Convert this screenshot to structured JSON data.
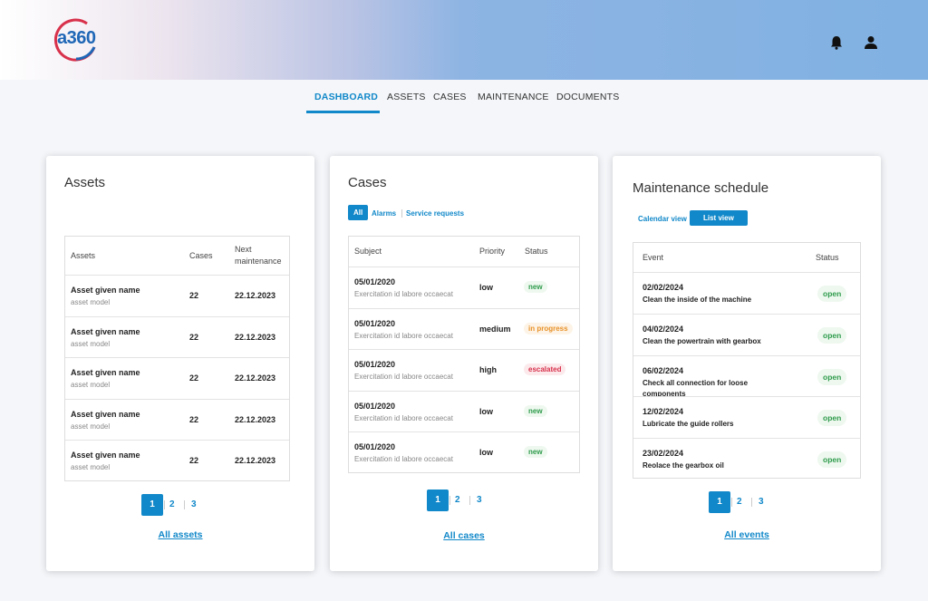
{
  "header": {
    "logo_text": "a360",
    "brand_color": "#1f67b6",
    "accent_red": "#d8314b"
  },
  "nav": {
    "items": [
      {
        "label": "DASHBOARD",
        "active": true
      },
      {
        "label": "ASSETS"
      },
      {
        "label": "CASES"
      },
      {
        "label": "MAINTENANCE"
      },
      {
        "label": "DOCUMENTS"
      }
    ]
  },
  "assets": {
    "title": "Assets",
    "columns": [
      "Assets",
      "Cases",
      "Next maintenance"
    ],
    "rows": [
      {
        "name": "Asset given name",
        "model": "asset model",
        "cases": "22",
        "next": "22.12.2023"
      },
      {
        "name": "Asset given name",
        "model": "asset model",
        "cases": "22",
        "next": "22.12.2023"
      },
      {
        "name": "Asset given name",
        "model": "asset model",
        "cases": "22",
        "next": "22.12.2023"
      },
      {
        "name": "Asset given name",
        "model": "asset model",
        "cases": "22",
        "next": "22.12.2023"
      },
      {
        "name": "Asset given name",
        "model": "asset model",
        "cases": "22",
        "next": "22.12.2023"
      }
    ],
    "pages": [
      "1",
      "2",
      "3"
    ],
    "link": "All assets"
  },
  "cases": {
    "title": "Cases",
    "filters": [
      "All",
      "Alarms",
      "Service requests"
    ],
    "columns": [
      "Subject",
      "Priority",
      "Status"
    ],
    "rows": [
      {
        "date": "05/01/2020",
        "desc": "Exercitation id labore occaecat",
        "priority": "low",
        "status": "new"
      },
      {
        "date": "05/01/2020",
        "desc": "Exercitation id labore occaecat",
        "priority": "medium",
        "status": "in progress"
      },
      {
        "date": "05/01/2020",
        "desc": "Exercitation id labore occaecat",
        "priority": "high",
        "status": "escalated"
      },
      {
        "date": "05/01/2020",
        "desc": "Exercitation id labore occaecat",
        "priority": "low",
        "status": "new"
      },
      {
        "date": "05/01/2020",
        "desc": "Exercitation id labore occaecat",
        "priority": "low",
        "status": "new"
      }
    ],
    "pages": [
      "1",
      "2",
      "3"
    ],
    "link": "All cases"
  },
  "maintenance": {
    "title": "Maintenance schedule",
    "views": [
      "Calendar view",
      "List view"
    ],
    "columns": [
      "Event",
      "Status"
    ],
    "rows": [
      {
        "date": "02/02/2024",
        "desc": "Clean the inside of the machine",
        "status": "open"
      },
      {
        "date": "04/02/2024",
        "desc": "Clean the powertrain with gearbox",
        "status": "open"
      },
      {
        "date": "06/02/2024",
        "desc": "Check all connection for loose",
        "desc2": "components",
        "status": "open"
      },
      {
        "date": "12/02/2024",
        "desc": "Lubricate the guide rollers",
        "status": "open"
      },
      {
        "date": "23/02/2024",
        "desc": "Reolace the gearbox oil",
        "status": "open"
      }
    ],
    "pages": [
      "1",
      "2",
      "3"
    ],
    "link": "All events"
  }
}
